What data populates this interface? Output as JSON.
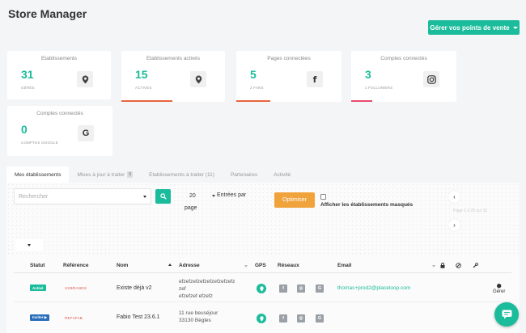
{
  "header": {
    "title": "Store Manager",
    "manage_button": "Gérer vos points de vente"
  },
  "cards": [
    {
      "title": "Etablissements",
      "value": "31",
      "sub": "gérés",
      "icon": "location-pin-icon",
      "bar_color": ""
    },
    {
      "title": "Etablissements activés",
      "value": "15",
      "sub": "activés",
      "icon": "location-pin-icon",
      "bar_color": "#e8643c"
    },
    {
      "title": "Pages connectées",
      "value": "5",
      "sub": "2 fans",
      "icon": "facebook-icon",
      "bar_color": "#e8643c"
    },
    {
      "title": "Comptes connectés",
      "value": "3",
      "sub": "1 followers",
      "icon": "instagram-icon",
      "bar_color": "#e84b6f"
    },
    {
      "title": "Comptes connectés",
      "value": "0",
      "sub": "comptes google",
      "icon": "google-icon",
      "bar_color": ""
    }
  ],
  "tabs": [
    {
      "label": "Mes établissements",
      "active": true
    },
    {
      "label": "Mises à jour à traiter",
      "badge": "0"
    },
    {
      "label": "Etablissements à traiter (11)"
    },
    {
      "label": "Partenaires"
    },
    {
      "label": "Activité"
    }
  ],
  "toolbar": {
    "search_placeholder": "Rechercher",
    "page_length": "20",
    "entries_label": "Entrées par",
    "page_label": "page",
    "optimize_button": "Optimiser",
    "hidden_label": "Afficher les établissements masqués",
    "pager_prev": "‹",
    "pager_next": "›",
    "pager_info": "Page 1 à 20 sur 31"
  },
  "table": {
    "headers": [
      "Statut",
      "Référence",
      "Nom",
      "Adresse",
      "GPS",
      "Réseaux",
      "Email"
    ],
    "rows": [
      {
        "status": "Activé",
        "status_color": "#1bbc9b",
        "reference": "XXBRANDS",
        "name": "Existe déjà v2",
        "address": [
          "efzefzefzefzefzefzefzefz",
          "zef",
          "efzefzef efzefz"
        ],
        "networks": [
          "f",
          "◎",
          "G"
        ],
        "email": "thomas+prod2@placeloop.com",
        "action": "Gérer"
      },
      {
        "status": "Inviter ▶",
        "status_color": "#2a6ebb",
        "reference": "REF1FAB",
        "name": "Fabio Test 23.6.1",
        "address": [
          "11 rue beuséjour",
          "33130 Bègles"
        ],
        "networks": [
          "f",
          "◎",
          "G"
        ],
        "email": "",
        "action": ""
      }
    ]
  },
  "colors": {
    "accent": "#1bbc9b",
    "warning": "#f0a23b"
  }
}
